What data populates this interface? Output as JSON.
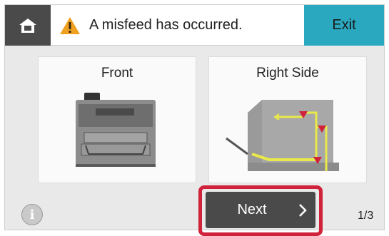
{
  "header": {
    "home_icon": "home-icon",
    "warning_icon": "warning-triangle-icon",
    "title": "A misfeed has occurred.",
    "exit_label": "Exit",
    "colors": {
      "topbar_home": "#4a4a4a",
      "exit": "#2aa8bf",
      "warning": "#f0a020"
    }
  },
  "panels": {
    "front_label": "Front",
    "side_label": "Right Side"
  },
  "footer": {
    "info_icon": "info-icon",
    "info_glyph": "i",
    "next_label": "Next",
    "next_icon": "chevron-right-icon",
    "page_indicator": "1/3",
    "highlight_color": "#d0223a"
  }
}
